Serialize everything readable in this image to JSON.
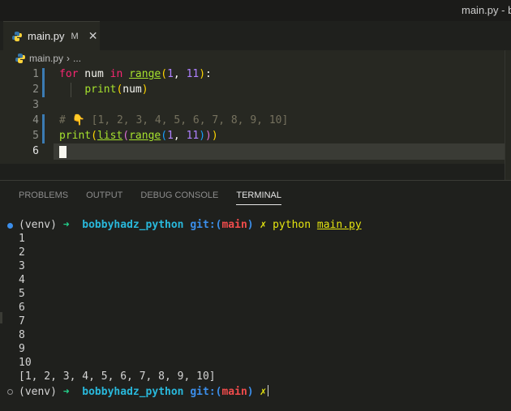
{
  "window": {
    "title": "main.py - b"
  },
  "tab": {
    "file_name": "main.py",
    "status": "M",
    "close_glyph": "✕"
  },
  "breadcrumb": {
    "file": "main.py",
    "sep": "›",
    "more": "..."
  },
  "editor": {
    "line_numbers": [
      "1",
      "2",
      "3",
      "4",
      "5",
      "6"
    ],
    "comment": "# 👇 [1, 2, 3, 4, 5, 6, 7, 8, 9, 10]"
  },
  "panel": {
    "tabs": [
      "PROBLEMS",
      "OUTPUT",
      "DEBUG CONSOLE",
      "TERMINAL"
    ]
  },
  "terminal": {
    "prompt_env": "(venv)",
    "prompt_arrow": "➜",
    "prompt_dir": "bobbyhadz_python",
    "prompt_git_label": "git:(",
    "prompt_branch": "main",
    "prompt_git_close": ")",
    "prompt_dirty": "✗",
    "command": "python",
    "command_arg": "main.py",
    "output": [
      "1",
      "2",
      "3",
      "4",
      "5",
      "6",
      "7",
      "8",
      "9",
      "10",
      "[1, 2, 3, 4, 5, 6, 7, 8, 9, 10]"
    ]
  },
  "colors": {
    "accent": "#3b8eea",
    "keyword": "#f92672",
    "function": "#a6e22e",
    "number": "#ae81ff",
    "comment": "#75715e"
  },
  "icons": {
    "file": "python-icon",
    "close": "close-icon"
  }
}
